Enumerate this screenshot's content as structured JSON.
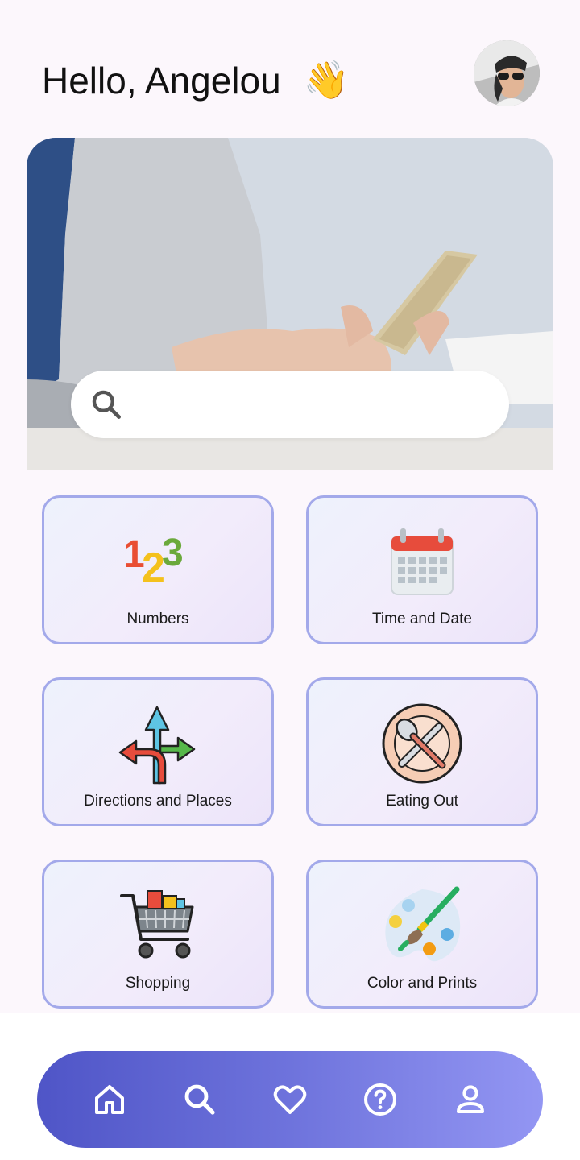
{
  "header": {
    "greeting": "Hello, Angelou",
    "wave_emoji": "👋"
  },
  "search": {
    "placeholder": ""
  },
  "categories": [
    {
      "label": "Numbers",
      "icon": "numbers-icon"
    },
    {
      "label": "Time and Date",
      "icon": "calendar-icon"
    },
    {
      "label": "Directions and Places",
      "icon": "directions-icon"
    },
    {
      "label": "Eating Out",
      "icon": "eating-out-icon"
    },
    {
      "label": "Shopping",
      "icon": "shopping-cart-icon"
    },
    {
      "label": "Color and Prints",
      "icon": "palette-icon"
    }
  ],
  "nav": {
    "items": [
      "home-icon",
      "search-icon",
      "heart-icon",
      "help-icon",
      "profile-icon"
    ]
  },
  "colors": {
    "background": "#fcf7fc",
    "card_border": "#a3a9ea",
    "nav_gradient_start": "#4f55c7",
    "nav_gradient_end": "#9396f3"
  }
}
